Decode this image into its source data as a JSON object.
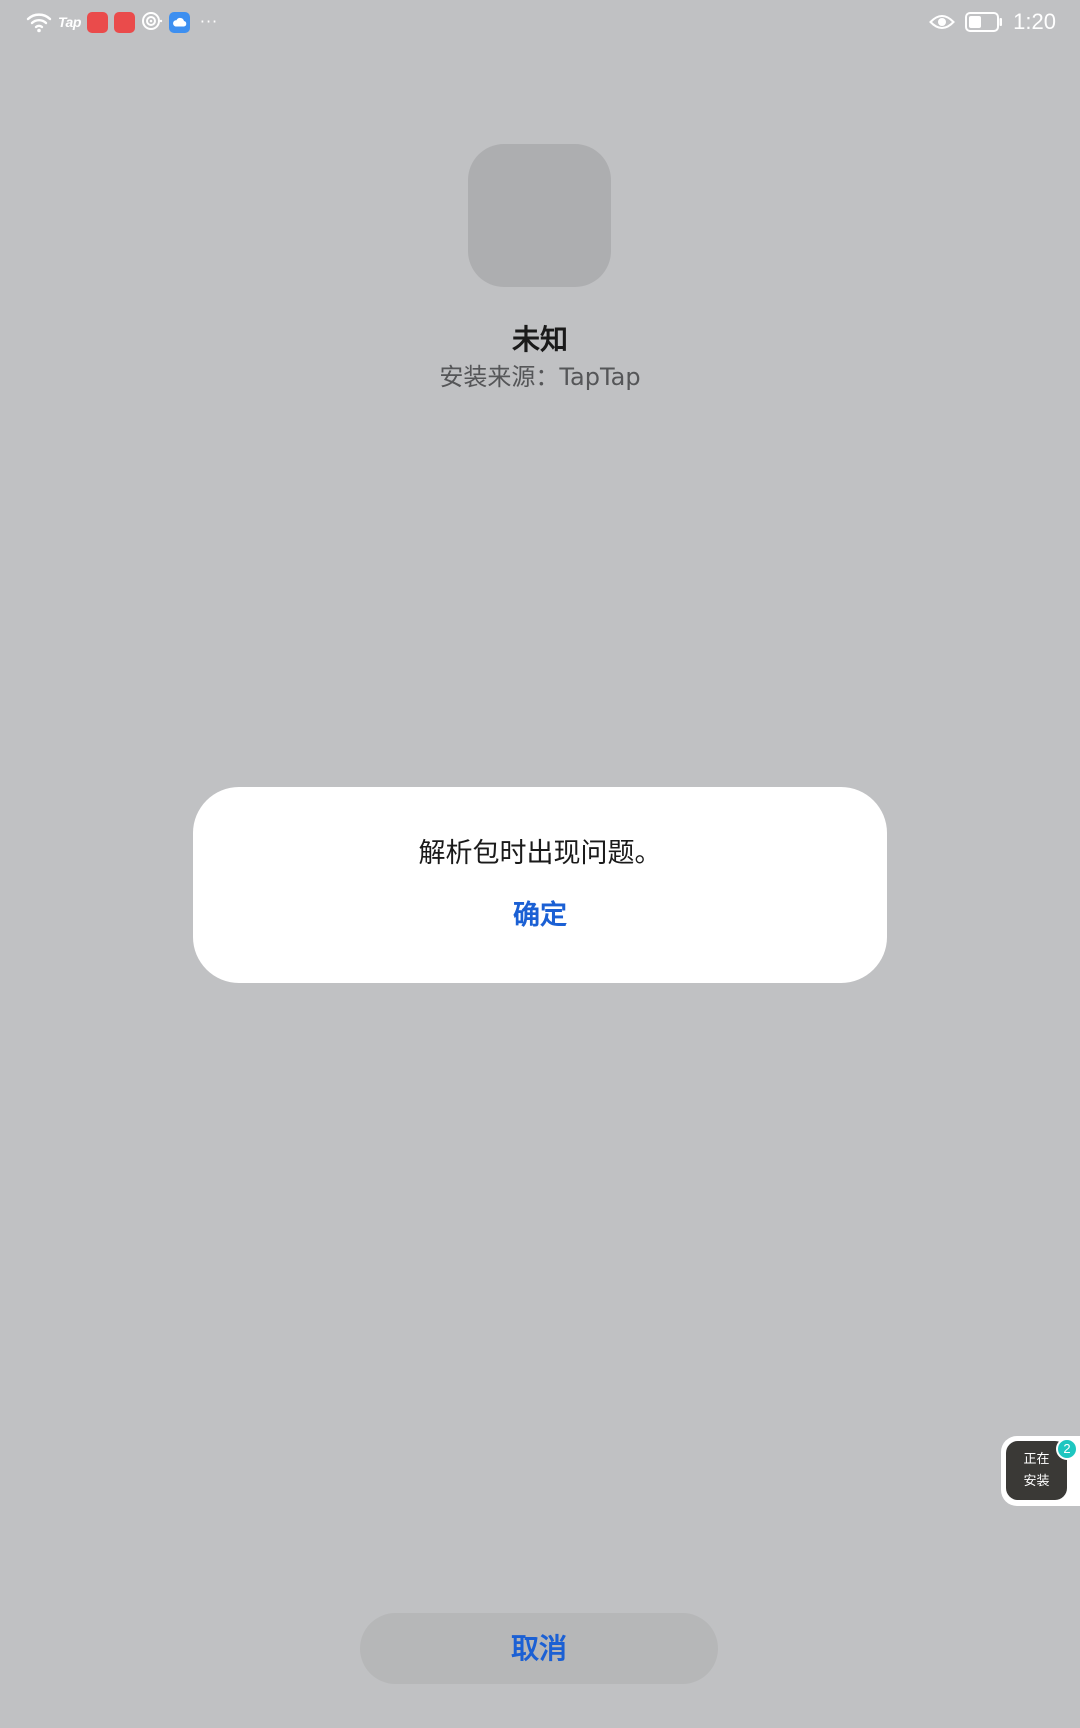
{
  "status_bar": {
    "left_icons": [
      "wifi-icon",
      "taptap-notification-icon",
      "shopping-app-icon",
      "shopping-app-icon",
      "hotspot-icon",
      "cloud-icon",
      "more-icon"
    ],
    "tap_label": "Tap",
    "more_label": "···",
    "right_icons": [
      "eye-comfort-icon",
      "battery-icon"
    ],
    "time": "1:20"
  },
  "app": {
    "icon": "app-placeholder-icon",
    "name": "未知",
    "install_source": "安装来源：TapTap"
  },
  "dialog": {
    "message": "解析包时出现问题。",
    "ok_label": "确定"
  },
  "installing_widget": {
    "line1": "正在",
    "line2": "安装",
    "badge_count": "2"
  },
  "footer": {
    "cancel_label": "取消"
  },
  "colors": {
    "background": "#c0c1c3",
    "accent": "#1b60d4",
    "dialog_bg": "#ffffff",
    "badge": "#1ec6c0"
  }
}
